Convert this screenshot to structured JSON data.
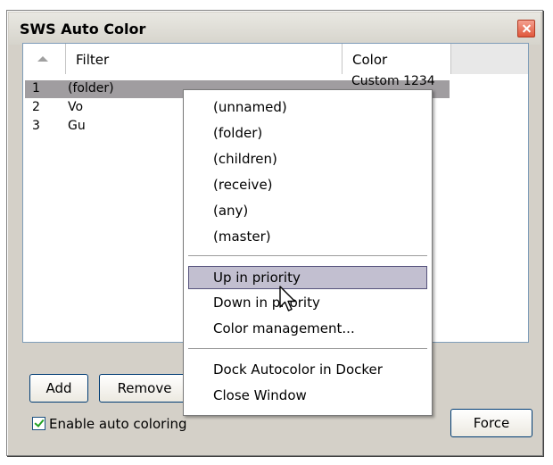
{
  "window": {
    "title": "SWS Auto Color"
  },
  "list": {
    "columns": {
      "filter": "Filter",
      "color": "Color"
    },
    "rows": [
      {
        "num": "1",
        "name": "(folder)",
        "color": "Custom 1234"
      },
      {
        "num": "2",
        "name": "Vo"
      },
      {
        "num": "3",
        "name": "Gu"
      }
    ]
  },
  "buttons": {
    "add": "Add",
    "remove": "Remove",
    "force": "Force"
  },
  "checkbox": {
    "label": "Enable auto coloring",
    "checked": true
  },
  "context_menu": {
    "items": [
      "(unnamed)",
      "(folder)",
      "(children)",
      "(receive)",
      "(any)",
      "(master)",
      "Up in priority",
      "Down in priority",
      "Color management...",
      "Dock Autocolor in Docker",
      "Close Window"
    ],
    "highlighted": "Up in priority"
  },
  "colors": {
    "selection": "#a09da0",
    "menu_hover": "#c2bfd0",
    "check": "#21a121"
  }
}
